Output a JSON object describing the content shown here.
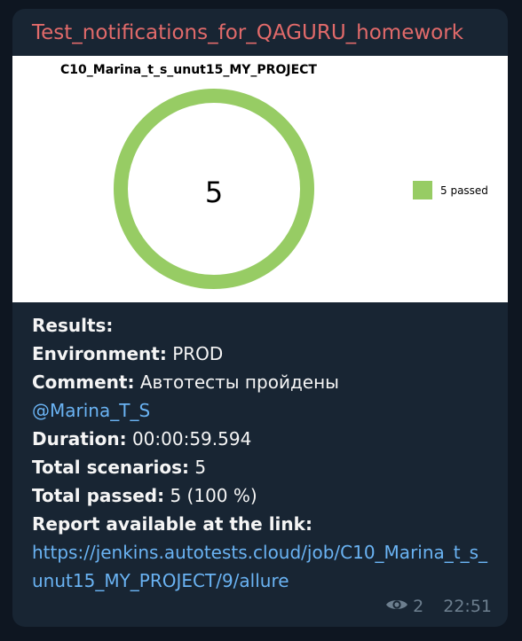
{
  "message": {
    "sender": "Test_notifications_for_QAGURU_homework",
    "views": "2",
    "time": "22:51",
    "views_icon": "eye-icon"
  },
  "chart_data": {
    "type": "pie",
    "title": "C10_Marina_t_s_unut15_MY_PROJECT",
    "center_label": "5",
    "categories": [
      "passed"
    ],
    "values": [
      5
    ],
    "legend": [
      "5 passed"
    ],
    "legend_position": "right",
    "colors": [
      "#97cc64"
    ]
  },
  "results": {
    "heading": "Results:",
    "environment_label": "Environment:",
    "environment_value": "PROD",
    "comment_label": "Comment:",
    "comment_value": "Автотесты пройдены",
    "mention": "@Marina_T_S",
    "duration_label": "Duration:",
    "duration_value": "00:00:59.594",
    "scenarios_label": "Total scenarios:",
    "scenarios_value": "5",
    "passed_label": "Total passed:",
    "passed_value": "5 (100 %)",
    "report_label": "Report available at the link:",
    "report_url": "https://jenkins.autotests.cloud/job/C10_Marina_t_s_unut15_MY_PROJECT/9/allure"
  },
  "colors": {
    "background": "#0e1621",
    "bubble": "#182533",
    "sender": "#e16a6a",
    "link": "#6ab3f3",
    "meta": "#6d7f8f"
  }
}
